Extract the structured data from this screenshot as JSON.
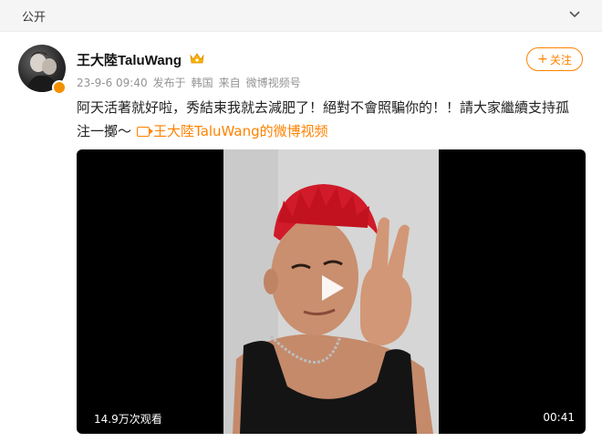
{
  "visibility": "公开",
  "author": {
    "name": "王大陸TaluWang",
    "verified_badge": "crown-icon"
  },
  "post": {
    "date": "23-9-6 09:40",
    "source_prefix": "发布于",
    "location": "韩国",
    "from_prefix": "来自",
    "client": "微博视频号",
    "text_line1": "阿天活著就好啦，秀結束我就去減肥了！絕對不會照騙你的！！請大家繼續支持孤",
    "text_line2": "注一擲～",
    "video_link": "王大陸TaluWang的微博视频"
  },
  "follow_label": "关注",
  "video": {
    "views": "14.9万次观看",
    "duration": "00:41"
  },
  "colors": {
    "accent": "#ff8200",
    "meta": "#939393"
  }
}
